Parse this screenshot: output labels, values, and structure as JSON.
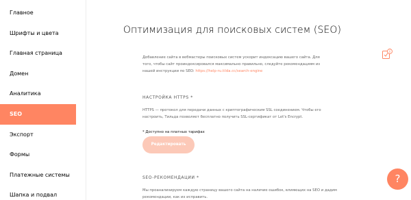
{
  "sidebar": {
    "items": [
      {
        "label": "Главное"
      },
      {
        "label": "Шрифты и цвета"
      },
      {
        "label": "Главная страница"
      },
      {
        "label": "Домен"
      },
      {
        "label": "Аналитика"
      },
      {
        "label": "SEO"
      },
      {
        "label": "Экспорт"
      },
      {
        "label": "Формы"
      },
      {
        "label": "Платежные системы"
      },
      {
        "label": "Шапка и подвал"
      }
    ],
    "active_index": 5
  },
  "main": {
    "title": "Оптимизация для поисковых систем (SEO)",
    "intro_text": "Добавление сайта в вебмастеры поисковых систем ускорит индексацию вашего сайта. Для того, чтобы сайт проиндексировался максимально правильно, следуйте рекомендациям из нашей инструкции по SEO: ",
    "intro_link": "https://help-ru.tilda.cc/search-engine",
    "https": {
      "heading": "НАСТРОЙКА HTTPS *",
      "text": "HTTPS — протокол для передачи данных с криптографическим SSL соединением. Чтобы его настроить, Тильда позволяет бесплатно получить SSL-сертификат от Let's Encrypt.",
      "note": "* Доступно на платных тарифах",
      "button_label": "Редактировать"
    },
    "seo": {
      "heading": "SEO-РЕКОМЕНДАЦИИ *",
      "text": "Мы проанализируем каждую страницу вашего сайта на наличие ошибок, влияющих на SEO и дадим рекомендации, как их исправить."
    }
  },
  "help_icon": {
    "name": "help-info-icon"
  },
  "fab": {
    "label": "?"
  },
  "colors": {
    "accent": "#ff8562",
    "button_disabled": "#fcc9b8",
    "background": "#f2f2f2"
  }
}
